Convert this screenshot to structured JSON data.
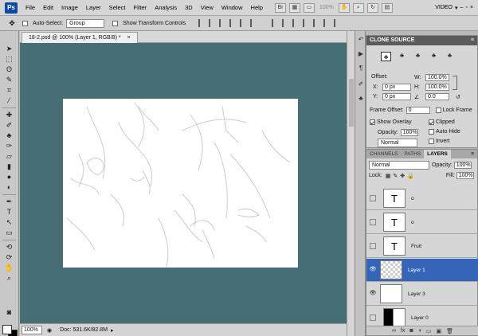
{
  "menu": {
    "logo": "Ps",
    "items": [
      "File",
      "Edit",
      "Image",
      "Layer",
      "Select",
      "Filter",
      "Analysis",
      "3D",
      "View",
      "Window",
      "Help"
    ],
    "zoom": "100%",
    "workspace": "VIDEO"
  },
  "options": {
    "auto_select_label": "Auto-Select:",
    "auto_select_value": "Group",
    "show_transform_label": "Show Transform Controls"
  },
  "document": {
    "tab_title": "18-2.psd @ 100% (Layer 1, RGB/8) *",
    "status_zoom": "100%",
    "doc_info": "Doc: 531.6K/82.8M"
  },
  "clone_source": {
    "title": "CLONE SOURCE",
    "offset_label": "Offset:",
    "x_label": "X:",
    "x_value": "0 px",
    "y_label": "Y:",
    "y_value": "0 px",
    "w_label": "W:",
    "w_value": "100.0%",
    "h_label": "H:",
    "h_value": "100.0%",
    "angle_value": "0.0",
    "frame_offset_label": "Frame Offset:",
    "frame_offset_value": "0",
    "lock_frame_label": "Lock Frame",
    "show_overlay_label": "Show Overlay",
    "clipped_label": "Clipped",
    "opacity_label": "Opacity:",
    "opacity_value": "100%",
    "auto_hide_label": "Auto Hide",
    "blend_value": "Normal",
    "invert_label": "Invert"
  },
  "layers_panel": {
    "tabs": [
      "CHANNELS",
      "PATHS",
      "LAYERS"
    ],
    "blend_mode": "Normal",
    "opacity_label": "Opacity:",
    "opacity_value": "100%",
    "lock_label": "Lock:",
    "fill_label": "Fill:",
    "fill_value": "100%",
    "layers": [
      {
        "name": "o",
        "type": "text",
        "visible": false,
        "active": false
      },
      {
        "name": "o",
        "type": "text",
        "visible": false,
        "active": false
      },
      {
        "name": "Fruit",
        "type": "text",
        "visible": false,
        "active": false
      },
      {
        "name": "Layer 1",
        "type": "transparent",
        "visible": true,
        "active": true
      },
      {
        "name": "Layer 3",
        "type": "white",
        "visible": true,
        "active": false
      },
      {
        "name": "Layer 0",
        "type": "half",
        "visible": false,
        "active": false
      }
    ]
  },
  "colors": {
    "canvas_bg": "#456f74",
    "active_layer": "#3465b8"
  }
}
